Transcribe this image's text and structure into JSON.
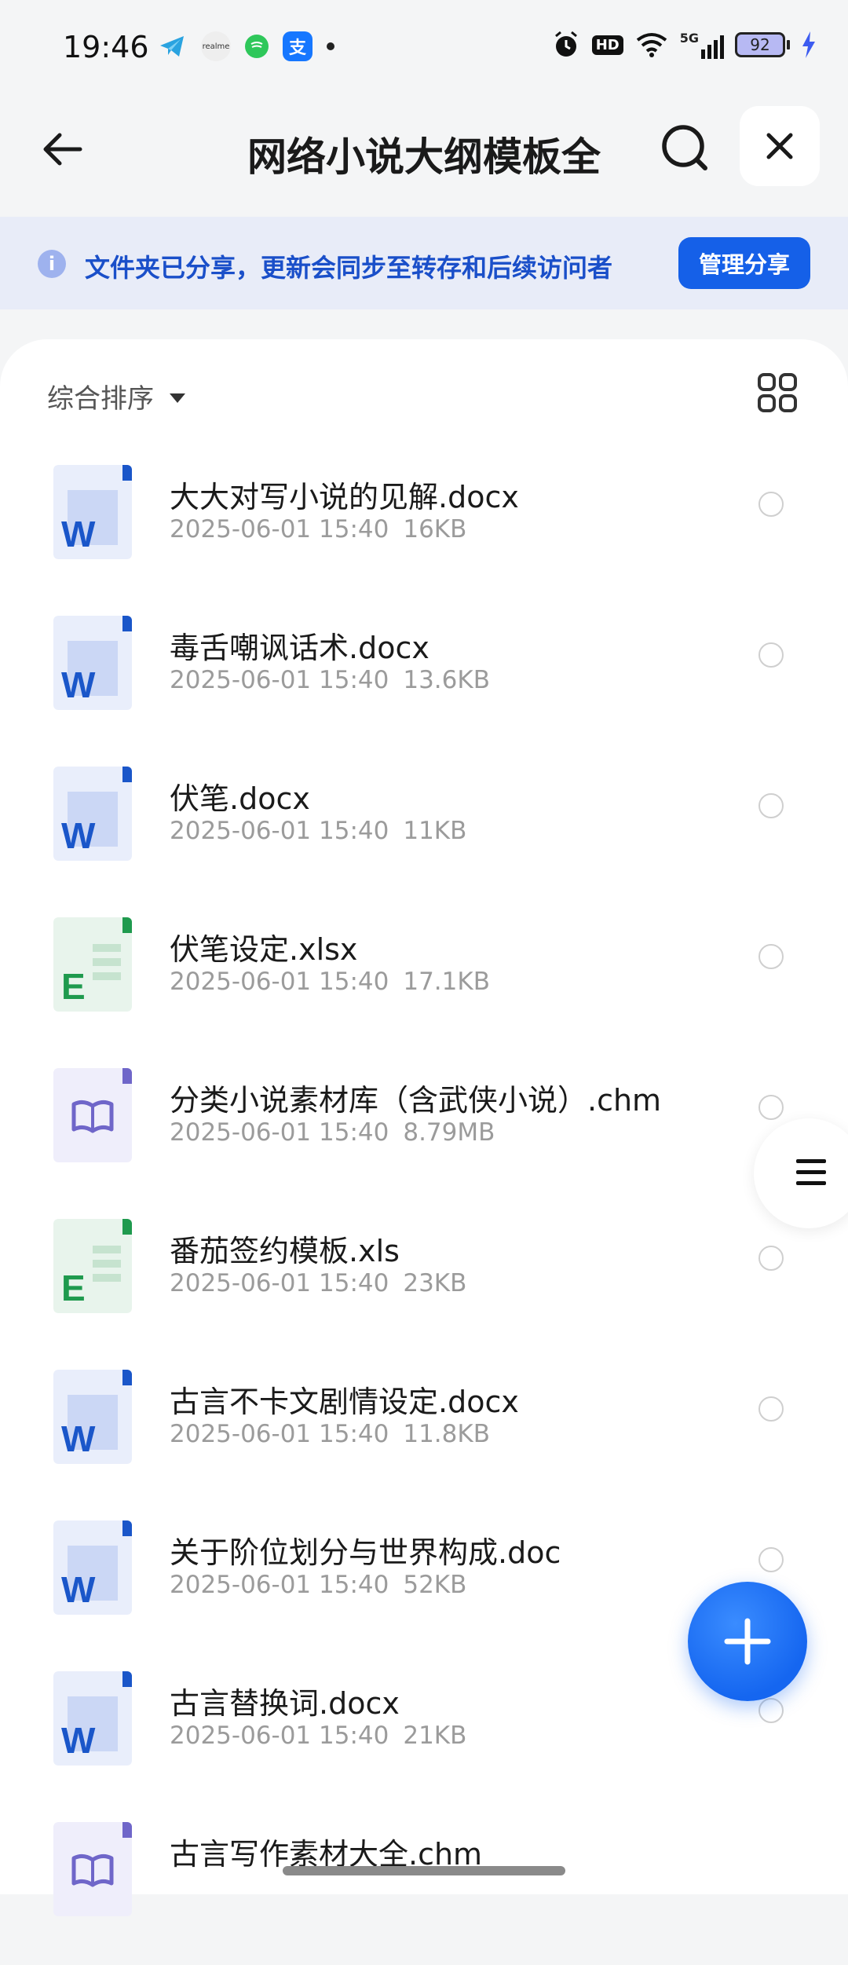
{
  "status": {
    "time": "19:46",
    "app_icons": [
      "telegram-icon",
      "realme-icon",
      "chat-icon",
      "alipay-icon"
    ],
    "realme_label": "realme",
    "alipay_label": "支",
    "hd": "HD",
    "network": "5G",
    "battery": "92"
  },
  "header": {
    "title": "网络小说大纲模板全"
  },
  "banner": {
    "message": "文件夹已分享，更新会同步至转存和后续访问者",
    "manage_label": "管理分享"
  },
  "toolbar": {
    "sort_label": "综合排序"
  },
  "files": [
    {
      "name": "大大对写小说的见解.docx",
      "date": "2025-06-01 15:40",
      "size": "16KB",
      "type": "word"
    },
    {
      "name": "毒舌嘲讽话术.docx",
      "date": "2025-06-01 15:40",
      "size": "13.6KB",
      "type": "word"
    },
    {
      "name": "伏笔.docx",
      "date": "2025-06-01 15:40",
      "size": "11KB",
      "type": "word"
    },
    {
      "name": "伏笔设定.xlsx",
      "date": "2025-06-01 15:40",
      "size": "17.1KB",
      "type": "excel"
    },
    {
      "name": "分类小说素材库（含武侠小说）.chm",
      "date": "2025-06-01 15:40",
      "size": "8.79MB",
      "type": "chm"
    },
    {
      "name": "番茄签约模板.xls",
      "date": "2025-06-01 15:40",
      "size": "23KB",
      "type": "excel"
    },
    {
      "name": "古言不卡文剧情设定.docx",
      "date": "2025-06-01 15:40",
      "size": "11.8KB",
      "type": "word"
    },
    {
      "name": "关于阶位划分与世界构成.doc",
      "date": "2025-06-01 15:40",
      "size": "52KB",
      "type": "word"
    },
    {
      "name": "古言替换词.docx",
      "date": "2025-06-01 15:40",
      "size": "21KB",
      "type": "word"
    },
    {
      "name": "古言写作素材大全.chm",
      "date": "",
      "size": "",
      "type": "chm"
    }
  ],
  "colors": {
    "accent": "#1560e8",
    "banner_bg": "#e8ecf8",
    "word_blue": "#1a56c9",
    "excel_green": "#1f9a4e",
    "chm_purple": "#6f66c9"
  }
}
